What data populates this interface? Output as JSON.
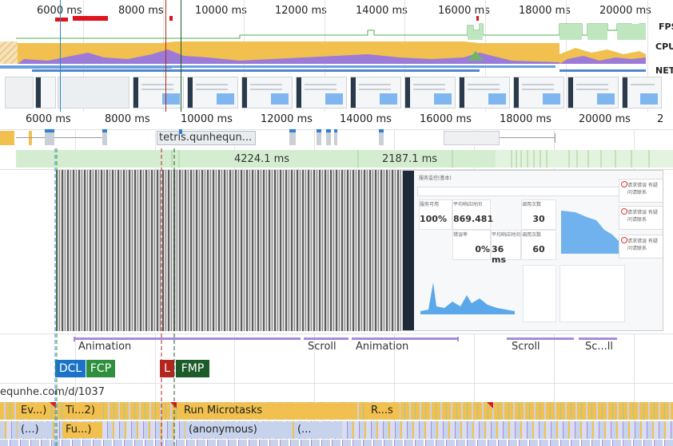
{
  "overview": {
    "ticks": [
      "6000 ms",
      "8000 ms",
      "10000 ms",
      "12000 ms",
      "14000 ms",
      "16000 ms",
      "18000 ms",
      "20000 ms"
    ],
    "labels": {
      "fps": "FPS",
      "cpu": "CPU",
      "net": "NET"
    }
  },
  "main": {
    "ticks": [
      "6000 ms",
      "8000 ms",
      "10000 ms",
      "12000 ms",
      "14000 ms",
      "16000 ms",
      "18000 ms",
      "20000 ms",
      "2"
    ],
    "network_url": "tetris.qunhequn...",
    "frames": {
      "left": "4224.1 ms",
      "right": "2187.1 ms"
    }
  },
  "screenshot": {
    "title": "服务监控(基本)",
    "stats": [
      {
        "label": "服务可用",
        "value": "100%"
      },
      {
        "label": "平均响应时间",
        "value": "869.481"
      },
      {
        "label": "调用次数",
        "value": "30"
      },
      {
        "label": "错误率",
        "value": "0%"
      },
      {
        "label": "平均响应时间",
        "value": "36 ms"
      },
      {
        "label": "调用次数",
        "value": "60"
      }
    ],
    "notifications": [
      "请求错误 有疑问请联系",
      "请求错误 有疑问请联系",
      "请求错误 有疑问请联系"
    ]
  },
  "interactions": [
    {
      "label": "Animation"
    },
    {
      "label": "Scroll"
    },
    {
      "label": "Animation"
    },
    {
      "label": "Scroll"
    },
    {
      "label": "Sc...ll"
    }
  ],
  "timings": {
    "dcl": "DCL",
    "fcp": "FCP",
    "l": "L",
    "fmp": "FMP"
  },
  "timing_colors": {
    "dcl": "#1a73c8",
    "fcp": "#2f8f3f",
    "l": "#b3261e",
    "fmp": "#1d5c2a"
  },
  "main_thread": {
    "url": "equnhe.com/d/1037",
    "row1": [
      "Ev...)",
      "Ti...2)",
      "Run Microtasks",
      "R...s"
    ],
    "row2": [
      "(...)",
      "Fu...)",
      "(anonymous)",
      "(..."
    ]
  }
}
